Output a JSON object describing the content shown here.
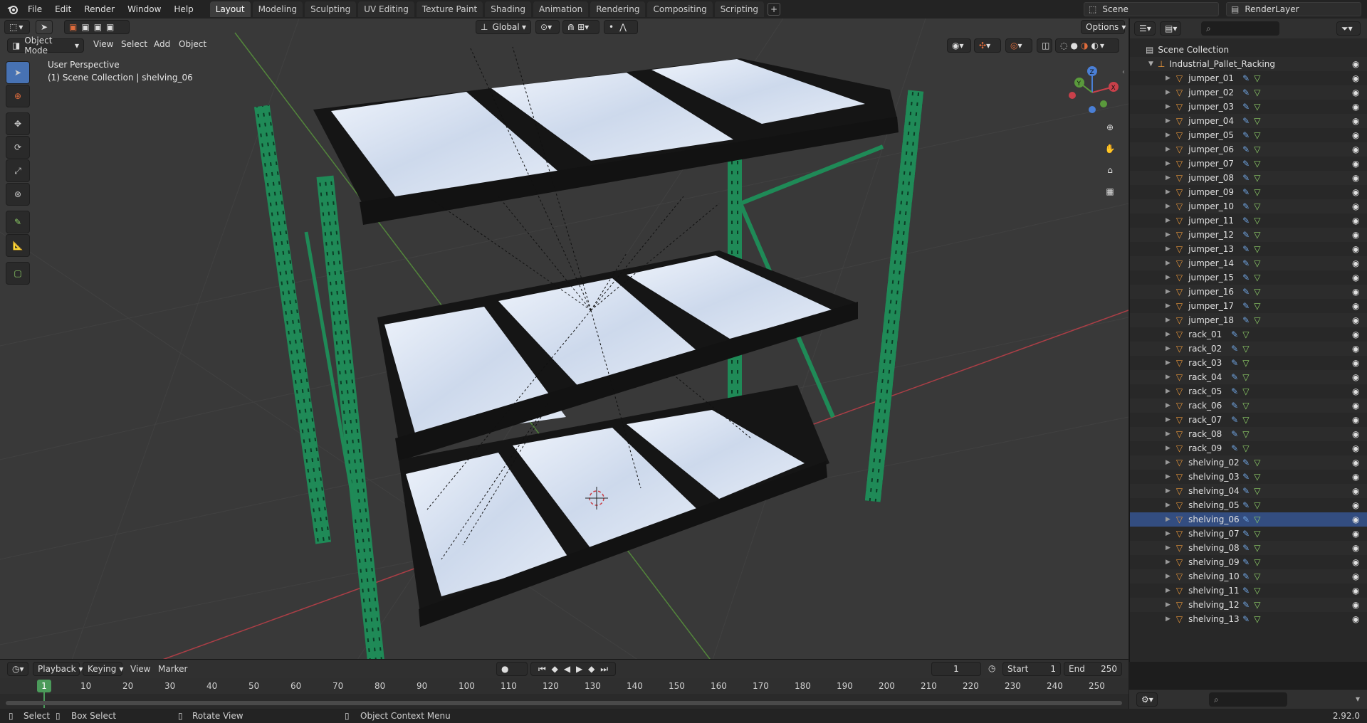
{
  "menubar": {
    "items": [
      "File",
      "Edit",
      "Render",
      "Window",
      "Help"
    ]
  },
  "workspaces": {
    "tabs": [
      "Layout",
      "Modeling",
      "Sculpting",
      "UV Editing",
      "Texture Paint",
      "Shading",
      "Animation",
      "Rendering",
      "Compositing",
      "Scripting"
    ],
    "active": "Layout",
    "add": "+"
  },
  "scene": {
    "name": "Scene"
  },
  "view_layer": {
    "name": "RenderLayer"
  },
  "viewport": {
    "mode": "Object Mode",
    "menus": [
      "View",
      "Select",
      "Add",
      "Object"
    ],
    "transform_orientation": "Global",
    "options_label": "Options",
    "perspective_label": "User Perspective",
    "context_label": "(1) Scene Collection | shelving_06",
    "gizmo_axes": {
      "x": "X",
      "y": "Y",
      "z": "Z"
    }
  },
  "outliner": {
    "root": "Scene Collection",
    "collection": "Industrial_Pallet_Racking",
    "items": [
      "jumper_01",
      "jumper_02",
      "jumper_03",
      "jumper_04",
      "jumper_05",
      "jumper_06",
      "jumper_07",
      "jumper_08",
      "jumper_09",
      "jumper_10",
      "jumper_11",
      "jumper_12",
      "jumper_13",
      "jumper_14",
      "jumper_15",
      "jumper_16",
      "jumper_17",
      "jumper_18",
      "rack_01",
      "rack_02",
      "rack_03",
      "rack_04",
      "rack_05",
      "rack_06",
      "rack_07",
      "rack_08",
      "rack_09",
      "shelving_02",
      "shelving_03",
      "shelving_04",
      "shelving_05",
      "shelving_06",
      "shelving_07",
      "shelving_08",
      "shelving_09",
      "shelving_10",
      "shelving_11",
      "shelving_12",
      "shelving_13"
    ],
    "selected": "shelving_06"
  },
  "timeline": {
    "menus": [
      "Playback",
      "Keying",
      "View",
      "Marker"
    ],
    "current_frame": "1",
    "start_label": "Start",
    "start": "1",
    "end_label": "End",
    "end": "250",
    "ruler": [
      "10",
      "20",
      "30",
      "40",
      "50",
      "60",
      "70",
      "80",
      "90",
      "100",
      "110",
      "120",
      "130",
      "140",
      "150",
      "160",
      "170",
      "180",
      "190",
      "200",
      "210",
      "220",
      "230",
      "240",
      "250"
    ],
    "playhead": "1"
  },
  "statusbar": {
    "select": "Select",
    "box_select": "Box Select",
    "rotate_view": "Rotate View",
    "context_menu": "Object Context Menu",
    "version": "2.92.0"
  },
  "colors": {
    "accent": "#4772b3",
    "rack_green": "#1f8a57",
    "beam_black": "#151515",
    "shelf_white": "#d8e2f2",
    "grid_bg": "#393939",
    "axis_red": "#c9404a",
    "axis_green": "#5a9a3c",
    "object_orange": "#e8963a",
    "modifier_blue": "#6fa3e0",
    "mesh_green": "#8fd068"
  }
}
